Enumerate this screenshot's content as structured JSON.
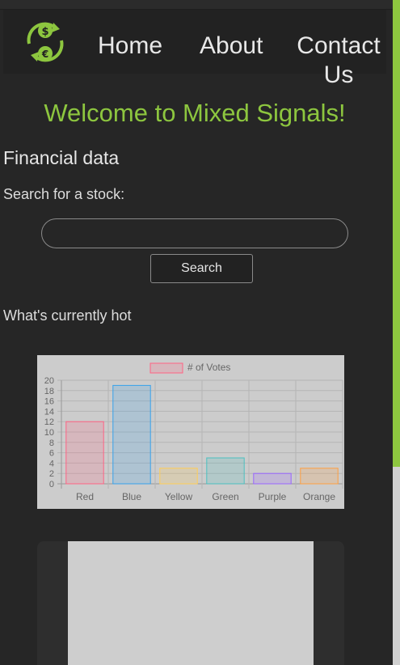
{
  "nav": {
    "home": "Home",
    "about": "About",
    "contact": "Contact Us"
  },
  "title": "Welcome to Mixed Signals!",
  "financial": {
    "heading": "Financial data",
    "search_label": "Search for a stock:",
    "search_value": "",
    "search_button": "Search"
  },
  "hot": {
    "heading": "What's currently hot"
  },
  "colors": {
    "accent": "#8dc63f",
    "background": "#262626"
  },
  "chart_data": {
    "type": "bar",
    "categories": [
      "Red",
      "Blue",
      "Yellow",
      "Green",
      "Purple",
      "Orange"
    ],
    "series": [
      {
        "name": "# of Votes",
        "values": [
          12,
          19,
          3,
          5,
          2,
          3
        ]
      }
    ],
    "ylim": [
      0,
      20
    ],
    "yticks": [
      0,
      2,
      4,
      6,
      8,
      10,
      12,
      14,
      16,
      18,
      20
    ],
    "legend": "top",
    "grid": true,
    "bar_colors": [
      "#ff6384",
      "#36a2eb",
      "#ffce56",
      "#4bc0c0",
      "#9966ff",
      "#ff9f40"
    ]
  }
}
